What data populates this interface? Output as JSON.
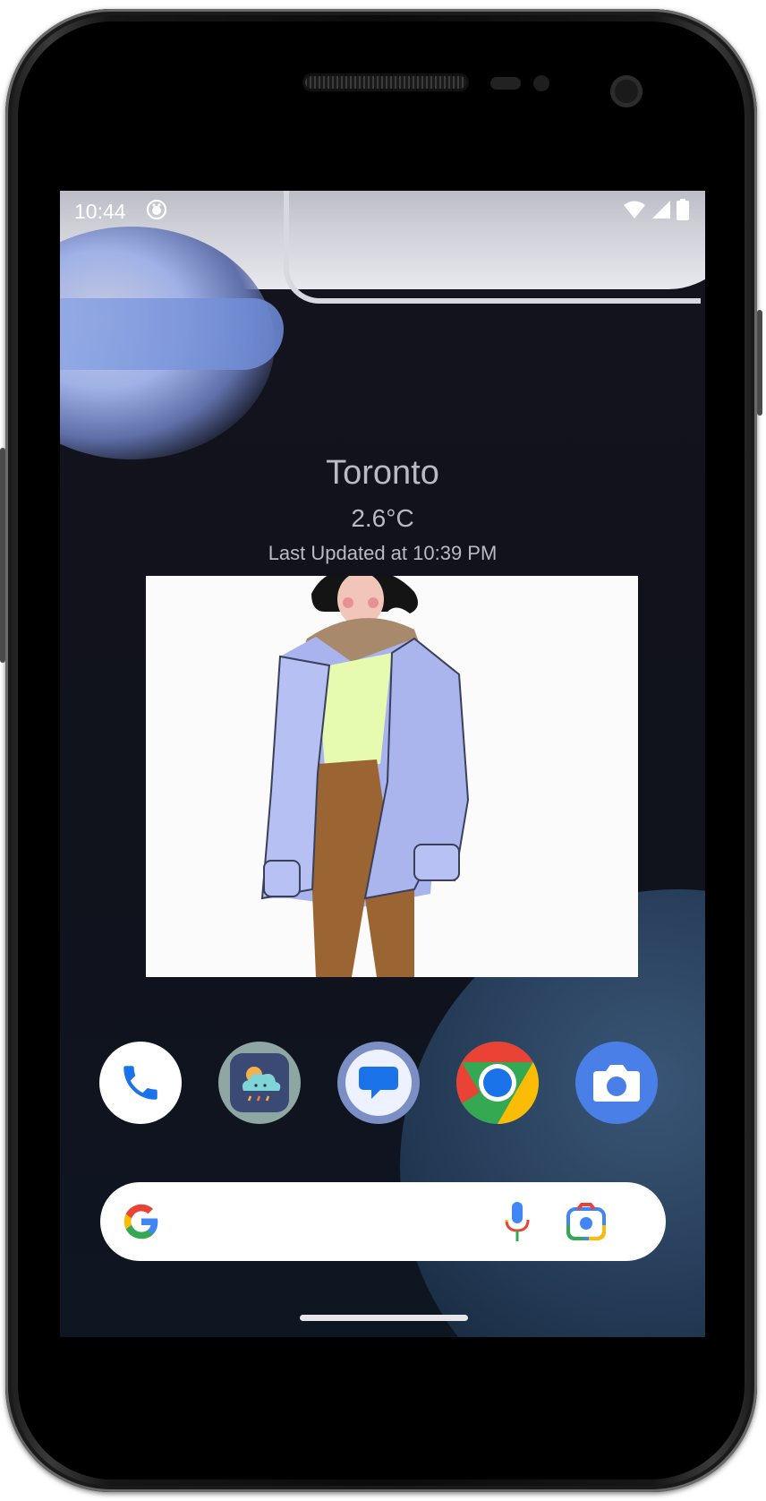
{
  "status_bar": {
    "time": "10:44",
    "notification_icon": "app-notification-icon",
    "icons": [
      "wifi-icon",
      "signal-icon",
      "battery-icon"
    ]
  },
  "weather": {
    "city": "Toronto",
    "temperature": "2.6°C",
    "last_updated": "Last Updated at 10:39 PM"
  },
  "outfit_image": {
    "description_icon": "outfit-illustration",
    "colors": {
      "coat": "#a9b4ef",
      "scarf": "#a9896b",
      "shirt": "#e6fbb0",
      "pants": "#9a6532"
    }
  },
  "dock": {
    "apps": [
      {
        "name": "Phone",
        "icon": "phone-icon"
      },
      {
        "name": "Weather Outfit",
        "icon": "weather-cloud-icon"
      },
      {
        "name": "Messages",
        "icon": "messages-icon"
      },
      {
        "name": "Chrome",
        "icon": "chrome-icon"
      },
      {
        "name": "Camera",
        "icon": "camera-icon"
      }
    ]
  },
  "search": {
    "google_icon": "google-g-icon",
    "mic_icon": "microphone-icon",
    "lens_icon": "google-lens-icon"
  },
  "colors": {
    "google_blue": "#4285f4",
    "google_red": "#ea4335",
    "google_yellow": "#fbbc05",
    "google_green": "#34a853",
    "weather_text": "#b9bbc3"
  }
}
